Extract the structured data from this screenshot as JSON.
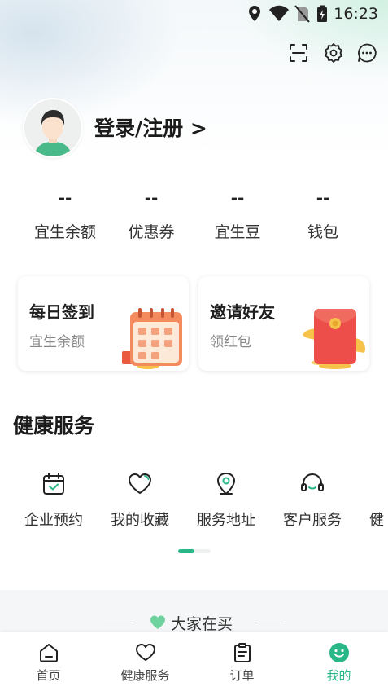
{
  "status_bar": {
    "time": "16:23"
  },
  "header": {
    "icons": [
      "scan-icon",
      "settings-icon",
      "message-icon"
    ],
    "login_label": "登录/注册 >"
  },
  "stats": [
    {
      "value": "--",
      "label": "宜生余额"
    },
    {
      "value": "--",
      "label": "优惠券"
    },
    {
      "value": "--",
      "label": "宜生豆"
    },
    {
      "value": "--",
      "label": "钱包"
    }
  ],
  "cards": [
    {
      "title": "每日签到",
      "subtitle": "宜生余额",
      "icon": "calendar-illustration"
    },
    {
      "title": "邀请好友",
      "subtitle": "领红包",
      "icon": "red-envelope-illustration"
    }
  ],
  "health_section": {
    "title": "健康服务",
    "items": [
      {
        "label": "企业预约",
        "icon": "calendar-check-icon"
      },
      {
        "label": "我的收藏",
        "icon": "heart-icon"
      },
      {
        "label": "服务地址",
        "icon": "location-pin-icon"
      },
      {
        "label": "客户服务",
        "icon": "headset-icon"
      },
      {
        "label": "健",
        "icon": "partial-item"
      }
    ]
  },
  "buy_section": {
    "title": "大家在买"
  },
  "tabbar": {
    "tabs": [
      {
        "label": "首页",
        "icon": "home-icon",
        "active": false
      },
      {
        "label": "健康服务",
        "icon": "heart-icon",
        "active": false
      },
      {
        "label": "订单",
        "icon": "clipboard-icon",
        "active": false
      },
      {
        "label": "我的",
        "icon": "smile-icon",
        "active": true
      }
    ]
  },
  "colors": {
    "accent": "#2ab787",
    "card_shadow": "#e5e5e5"
  }
}
